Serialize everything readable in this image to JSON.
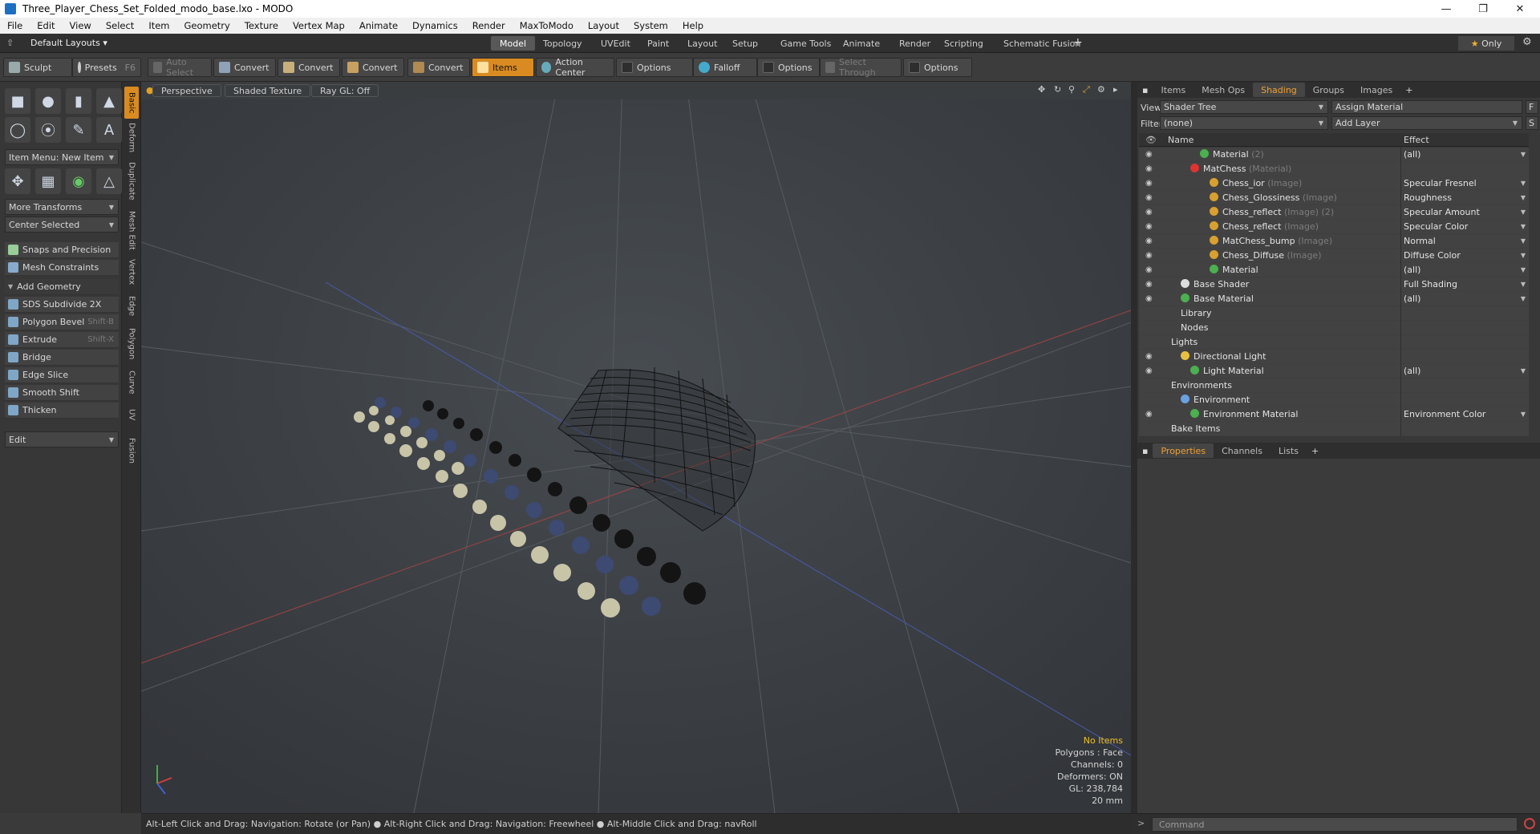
{
  "window": {
    "title": "Three_Player_Chess_Set_Folded_modo_base.lxo - MODO"
  },
  "menu": [
    "File",
    "Edit",
    "View",
    "Select",
    "Item",
    "Geometry",
    "Texture",
    "Vertex Map",
    "Animate",
    "Dynamics",
    "Render",
    "MaxToModo",
    "Layout",
    "System",
    "Help"
  ],
  "layoutbar": {
    "preset": "Default Layouts",
    "tabs": [
      "Model",
      "Topology",
      "UVEdit",
      "Paint",
      "Layout",
      "Setup",
      "Game Tools",
      "Animate",
      "Render",
      "Scripting",
      "Schematic Fusion"
    ],
    "active_tab": "Model",
    "only_label": "Only"
  },
  "toolbar": {
    "sculpt": "Sculpt",
    "presets": "Presets",
    "presets_hotkey": "F6",
    "auto_select": "Auto Select",
    "convert": "Convert",
    "items": "Items",
    "action_center": "Action Center",
    "options": "Options",
    "falloff": "Falloff",
    "select_through": "Select Through"
  },
  "left": {
    "item_menu": "Item Menu: New Item",
    "more_transforms": "More Transforms",
    "center_selected": "Center Selected",
    "snaps": "Snaps and Precision",
    "mesh_constraints": "Mesh Constraints",
    "add_geometry": "Add Geometry",
    "tools": [
      {
        "label": "SDS Subdivide 2X",
        "hotkey": ""
      },
      {
        "label": "Polygon Bevel",
        "hotkey": "Shift-B"
      },
      {
        "label": "Extrude",
        "hotkey": "Shift-X"
      },
      {
        "label": "Bridge",
        "hotkey": ""
      },
      {
        "label": "Edge Slice",
        "hotkey": ""
      },
      {
        "label": "Smooth Shift",
        "hotkey": ""
      },
      {
        "label": "Thicken",
        "hotkey": ""
      }
    ],
    "edit": "Edit"
  },
  "vtabs": [
    "Basic",
    "Deform",
    "Duplicate",
    "Mesh Edit",
    "Vertex",
    "Edge",
    "Polygon",
    "Curve",
    "UV",
    "Fusion"
  ],
  "viewport": {
    "view": "Perspective",
    "shading": "Shaded Texture",
    "raygl": "Ray GL: Off",
    "info": {
      "items": "No Items",
      "polygons": "Polygons : Face",
      "channels": "Channels: 0",
      "deformers": "Deformers: ON",
      "gl": "GL: 238,784",
      "scale": "20 mm"
    }
  },
  "status": "Alt-Left Click and Drag: Navigation: Rotate (or Pan) ● Alt-Right Click and Drag: Navigation: Freewheel ● Alt-Middle Click and Drag: navRoll",
  "shading": {
    "tabs": [
      "Items",
      "Mesh Ops",
      "Shading",
      "Groups",
      "Images"
    ],
    "active_tab": "Shading",
    "view_label": "View",
    "view_value": "Shader Tree",
    "assign": "Assign Material",
    "filter_label": "Filter",
    "filter_value": "(none)",
    "add_layer": "Add Layer",
    "col_name": "Name",
    "col_effect": "Effect",
    "rows": [
      {
        "indent": 3,
        "name": "Material",
        "type": "(2)",
        "effect": "(all)",
        "ball": "#4caf50",
        "eye": true
      },
      {
        "indent": 2,
        "name": "MatChess",
        "type": "(Material)",
        "effect": "",
        "ball": "#d33",
        "eye": true
      },
      {
        "indent": 4,
        "name": "Chess_ior",
        "type": "(Image)",
        "effect": "Specular Fresnel",
        "ball": "#d8a030",
        "eye": true
      },
      {
        "indent": 4,
        "name": "Chess_Glossiness",
        "type": "(Image)",
        "effect": "Roughness",
        "ball": "#d8a030",
        "eye": true
      },
      {
        "indent": 4,
        "name": "Chess_reflect",
        "type": "(Image) (2)",
        "effect": "Specular Amount",
        "ball": "#d8a030",
        "eye": true
      },
      {
        "indent": 4,
        "name": "Chess_reflect",
        "type": "(Image)",
        "effect": "Specular Color",
        "ball": "#d8a030",
        "eye": true
      },
      {
        "indent": 4,
        "name": "MatChess_bump",
        "type": "(Image)",
        "effect": "Normal",
        "ball": "#d8a030",
        "eye": true
      },
      {
        "indent": 4,
        "name": "Chess_Diffuse",
        "type": "(Image)",
        "effect": "Diffuse Color",
        "ball": "#d8a030",
        "eye": true
      },
      {
        "indent": 4,
        "name": "Material",
        "type": "",
        "effect": "(all)",
        "ball": "#4caf50",
        "eye": true
      },
      {
        "indent": 1,
        "name": "Base Shader",
        "type": "",
        "effect": "Full Shading",
        "ball": "#dddddd",
        "eye": true
      },
      {
        "indent": 1,
        "name": "Base Material",
        "type": "",
        "effect": "(all)",
        "ball": "#4caf50",
        "eye": true
      },
      {
        "indent": 1,
        "name": "Library",
        "type": "",
        "effect": "",
        "ball": "",
        "eye": false
      },
      {
        "indent": 1,
        "name": "Nodes",
        "type": "",
        "effect": "",
        "ball": "",
        "eye": false
      },
      {
        "indent": 0,
        "name": "Lights",
        "type": "",
        "effect": "",
        "ball": "",
        "eye": false
      },
      {
        "indent": 1,
        "name": "Directional Light",
        "type": "",
        "effect": "",
        "ball": "#e8c040",
        "eye": true
      },
      {
        "indent": 2,
        "name": "Light Material",
        "type": "",
        "effect": "(all)",
        "ball": "#4caf50",
        "eye": true
      },
      {
        "indent": 0,
        "name": "Environments",
        "type": "",
        "effect": "",
        "ball": "",
        "eye": false
      },
      {
        "indent": 1,
        "name": "Environment",
        "type": "",
        "effect": "",
        "ball": "#6aa0e0",
        "eye": false
      },
      {
        "indent": 2,
        "name": "Environment Material",
        "type": "",
        "effect": "Environment Color",
        "ball": "#4caf50",
        "eye": true
      },
      {
        "indent": 0,
        "name": "Bake Items",
        "type": "",
        "effect": "",
        "ball": "",
        "eye": false
      }
    ]
  },
  "props_tabs": [
    "Properties",
    "Channels",
    "Lists"
  ],
  "command_placeholder": "Command"
}
